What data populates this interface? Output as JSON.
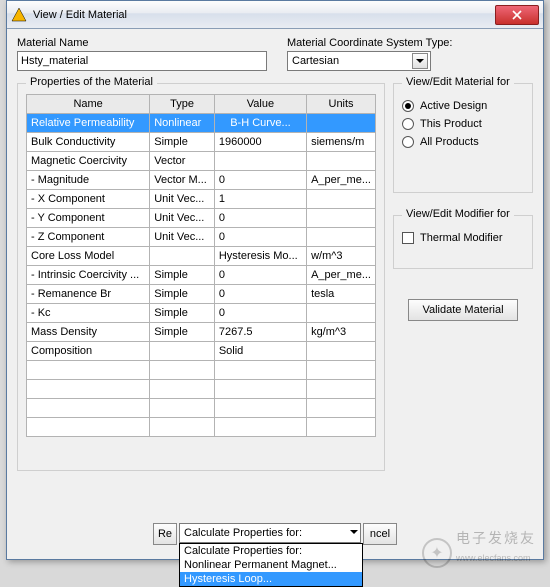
{
  "window": {
    "title": "View / Edit Material"
  },
  "material_name": {
    "label": "Material Name",
    "value": "Hsty_material"
  },
  "coord": {
    "label": "Material Coordinate System Type:",
    "value": "Cartesian"
  },
  "props_group": {
    "legend": "Properties of the Material"
  },
  "table": {
    "headers": {
      "name": "Name",
      "type": "Type",
      "value": "Value",
      "units": "Units"
    },
    "rows": [
      {
        "name": "Relative Permeability",
        "type": "Nonlinear",
        "value": "B-H Curve...",
        "units": "",
        "selected": true,
        "btn": true
      },
      {
        "name": "Bulk Conductivity",
        "type": "Simple",
        "value": "1960000",
        "units": "siemens/m"
      },
      {
        "name": "Magnetic Coercivity",
        "type": "Vector",
        "value": "",
        "units": ""
      },
      {
        "name": "- Magnitude",
        "type": "Vector M...",
        "value": "0",
        "units": "A_per_me..."
      },
      {
        "name": "- X Component",
        "type": "Unit Vec...",
        "value": "1",
        "units": ""
      },
      {
        "name": "- Y Component",
        "type": "Unit Vec...",
        "value": "0",
        "units": ""
      },
      {
        "name": "- Z Component",
        "type": "Unit Vec...",
        "value": "0",
        "units": ""
      },
      {
        "name": "Core Loss Model",
        "type": "",
        "value": "Hysteresis Mo...",
        "units": "w/m^3"
      },
      {
        "name": "- Intrinsic Coercivity ...",
        "type": "Simple",
        "value": "0",
        "units": "A_per_me..."
      },
      {
        "name": "- Remanence Br",
        "type": "Simple",
        "value": "0",
        "units": "tesla"
      },
      {
        "name": "- Kc",
        "type": "Simple",
        "value": "0",
        "units": ""
      },
      {
        "name": "Mass Density",
        "type": "Simple",
        "value": "7267.5",
        "units": "kg/m^3"
      },
      {
        "name": "Composition",
        "type": "",
        "value": "Solid",
        "units": ""
      }
    ]
  },
  "view_edit": {
    "legend": "View/Edit Material for",
    "opt1": "Active Design",
    "opt2": "This Product",
    "opt3": "All Products"
  },
  "modifier": {
    "legend": "View/Edit Modifier for",
    "opt1": "Thermal Modifier"
  },
  "validate": "Validate Material",
  "bottom": {
    "reset_partial": "Re",
    "cancel_partial": "ncel",
    "calc_label": "Calculate Properties for:",
    "dd1": "Calculate Properties for:",
    "dd2": "Nonlinear Permanent Magnet...",
    "dd3": "Hysteresis Loop..."
  }
}
